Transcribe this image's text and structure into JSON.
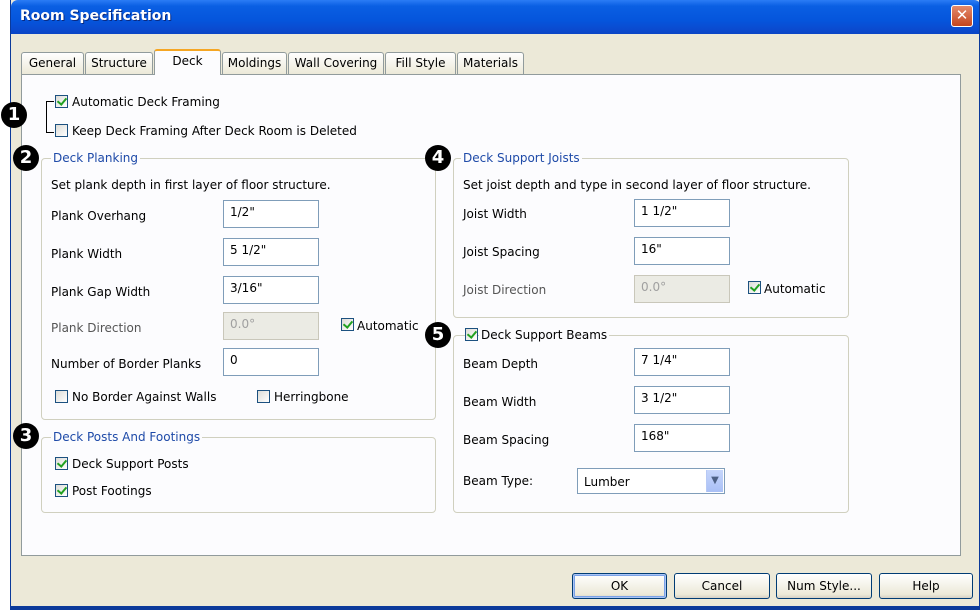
{
  "window": {
    "title": "Room Specification",
    "close_glyph": "✕"
  },
  "tabs": [
    {
      "label": "General"
    },
    {
      "label": "Structure"
    },
    {
      "label": "Deck",
      "active": true
    },
    {
      "label": "Moldings"
    },
    {
      "label": "Wall Covering"
    },
    {
      "label": "Fill Style"
    },
    {
      "label": "Materials"
    }
  ],
  "badges": [
    "1",
    "2",
    "3",
    "4",
    "5"
  ],
  "framing": {
    "automatic_label": "Automatic Deck Framing",
    "automatic_checked": true,
    "keep_label": "Keep Deck Framing After Deck Room is Deleted",
    "keep_checked": false
  },
  "planking": {
    "title": "Deck Planking",
    "description": "Set plank depth in first layer of floor structure.",
    "overhang_label": "Plank Overhang",
    "overhang_value": "1/2\"",
    "width_label": "Plank Width",
    "width_value": "5 1/2\"",
    "gap_label": "Plank Gap Width",
    "gap_value": "3/16\"",
    "direction_label": "Plank Direction",
    "direction_value": "0.0°",
    "automatic_label": "Automatic",
    "automatic_checked": true,
    "border_label": "Number of Border Planks",
    "border_value": "0",
    "no_border_label": "No Border Against Walls",
    "no_border_checked": false,
    "herringbone_label": "Herringbone",
    "herringbone_checked": false
  },
  "posts": {
    "title": "Deck Posts And Footings",
    "support_label": "Deck Support Posts",
    "support_checked": true,
    "footings_label": "Post Footings",
    "footings_checked": true
  },
  "joists": {
    "title": "Deck Support Joists",
    "description": "Set joist depth and type in second layer of floor structure.",
    "width_label": "Joist Width",
    "width_value": "1 1/2\"",
    "spacing_label": "Joist Spacing",
    "spacing_value": "16\"",
    "direction_label": "Joist Direction",
    "direction_value": "0.0°",
    "automatic_label": "Automatic",
    "automatic_checked": true
  },
  "beams": {
    "title": "Deck Support Beams",
    "enabled": true,
    "depth_label": "Beam Depth",
    "depth_value": "7 1/4\"",
    "width_label": "Beam Width",
    "width_value": "3 1/2\"",
    "spacing_label": "Beam Spacing",
    "spacing_value": "168\"",
    "type_label": "Beam Type:",
    "type_value": "Lumber"
  },
  "buttons": {
    "ok": "OK",
    "cancel": "Cancel",
    "num_style": "Num Style...",
    "help": "Help"
  },
  "colors": {
    "titlebar": "#0555dc",
    "dialog_bg": "#ece9d8",
    "panel_bg": "#fcfcfe",
    "group_title": "#1e4aa8",
    "check_mark": "#21a121",
    "active_tab_accent": "#f5a623"
  }
}
